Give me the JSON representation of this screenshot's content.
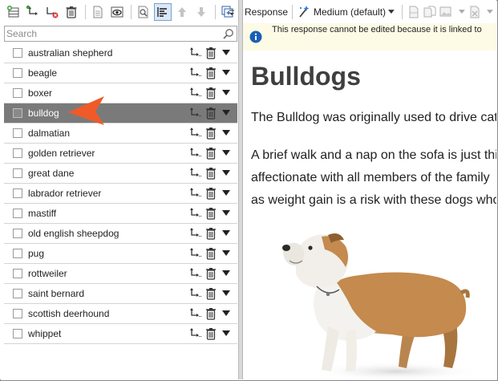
{
  "left_toolbar": {
    "icons": [
      "add-row-icon",
      "move-icon",
      "remove-formatting-icon",
      "delete-icon",
      "document-icon",
      "preview-icon",
      "search-document-icon",
      "align-left-icon",
      "move-up-icon",
      "move-down-icon",
      "copy-icon",
      "overflow-icon"
    ]
  },
  "search": {
    "placeholder": "Search",
    "value": ""
  },
  "options": [
    {
      "label": "australian shepherd",
      "checked": false,
      "selected": false
    },
    {
      "label": "beagle",
      "checked": false,
      "selected": false
    },
    {
      "label": "boxer",
      "checked": false,
      "selected": false
    },
    {
      "label": "bulldog",
      "checked": false,
      "selected": true
    },
    {
      "label": "dalmatian",
      "checked": false,
      "selected": false
    },
    {
      "label": "golden retriever",
      "checked": false,
      "selected": false
    },
    {
      "label": "great dane",
      "checked": false,
      "selected": false
    },
    {
      "label": "labrador retriever",
      "checked": false,
      "selected": false
    },
    {
      "label": "mastiff",
      "checked": false,
      "selected": false
    },
    {
      "label": "old english sheepdog",
      "checked": false,
      "selected": false
    },
    {
      "label": "pug",
      "checked": false,
      "selected": false
    },
    {
      "label": "rottweiler",
      "checked": false,
      "selected": false
    },
    {
      "label": "saint bernard",
      "checked": false,
      "selected": false
    },
    {
      "label": "scottish deerhound",
      "checked": false,
      "selected": false
    },
    {
      "label": "whippet",
      "checked": false,
      "selected": false
    }
  ],
  "right_toolbar": {
    "response_label": "Response",
    "quality_value": "Medium (default)"
  },
  "notice": {
    "text": "This response cannot be edited because it is linked to"
  },
  "content": {
    "title": "Bulldogs",
    "para1": "The Bulldog was originally used to drive cat",
    "para2_line1": "A brief walk and a nap on the sofa is just thi",
    "para2_line2": "affectionate with all members of the family",
    "para2_line3": "as weight gain is a risk with these dogs who"
  },
  "colors": {
    "selected_row": "#7a7a7a",
    "callout_arrow": "#f05a28",
    "notice_bg": "#fdfbe6",
    "info_icon": "#1a5fb4"
  }
}
